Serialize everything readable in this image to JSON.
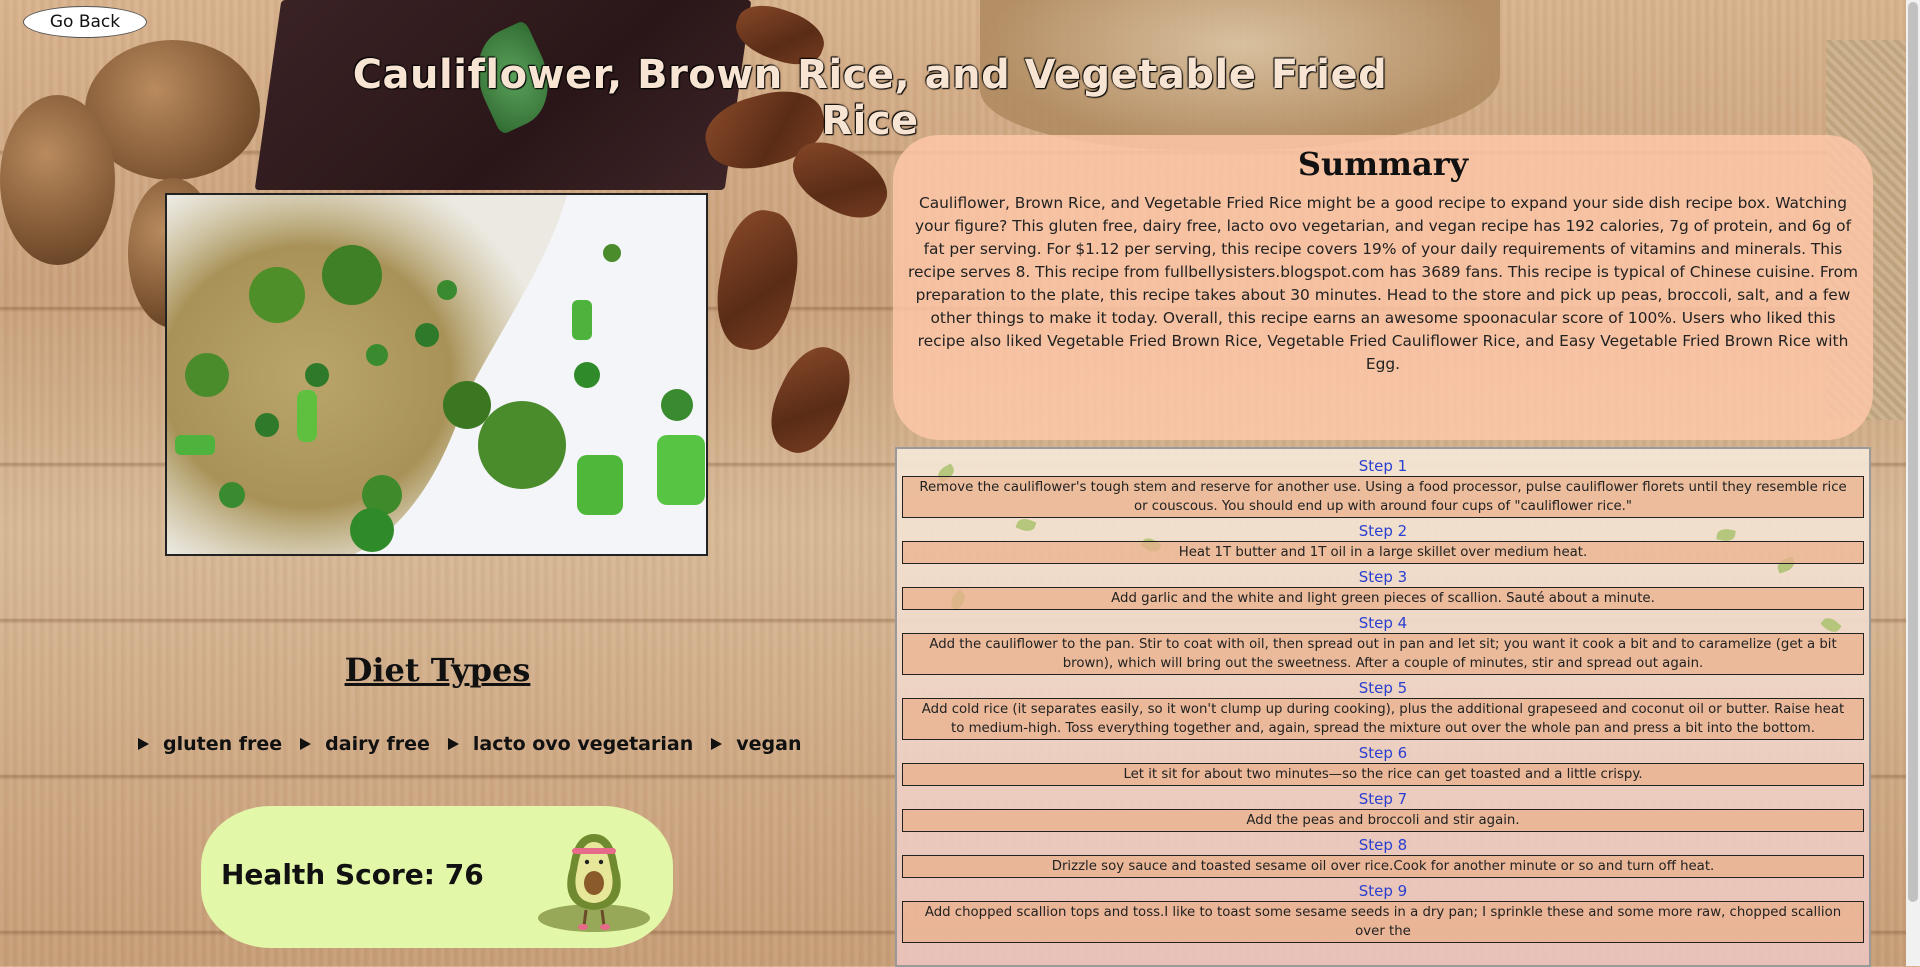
{
  "nav": {
    "go_back_label": "Go Back"
  },
  "recipe": {
    "title": "Cauliflower, Brown Rice, and Vegetable Fried Rice"
  },
  "summary": {
    "heading": "Summary",
    "text": "Cauliflower, Brown Rice, and Vegetable Fried Rice might be a good recipe to expand your side dish recipe box. Watching your figure? This gluten free, dairy free, lacto ovo vegetarian, and vegan recipe has 192 calories, 7g of protein, and 6g of fat per serving. For $1.12 per serving, this recipe covers 19% of your daily requirements of vitamins and minerals. This recipe serves 8. This recipe from fullbellysisters.blogspot.com has 3689 fans. This recipe is typical of Chinese cuisine. From preparation to the plate, this recipe takes about 30 minutes. Head to the store and pick up peas, broccoli, salt, and a few other things to make it today. Overall, this recipe earns an awesome spoonacular score of 100%. Users who liked this recipe also liked Vegetable Fried Brown Rice, Vegetable Fried Cauliflower Rice, and Easy Vegetable Fried Brown Rice with Egg."
  },
  "diet": {
    "heading": "Diet Types",
    "types": [
      "gluten free",
      "dairy free",
      "lacto ovo vegetarian",
      "vegan"
    ]
  },
  "health": {
    "label": "Health Score: 76",
    "score": 76
  },
  "steps": [
    {
      "label": "Step 1",
      "text": "Remove the cauliflower's tough stem and reserve for another use. Using a food processor, pulse cauliflower florets until they resemble rice or couscous. You should end up with around four cups of \"cauliflower rice.\""
    },
    {
      "label": "Step 2",
      "text": "Heat 1T butter and 1T oil in a large skillet over medium heat."
    },
    {
      "label": "Step 3",
      "text": "Add garlic and the white and light green pieces of scallion. Sauté about a minute."
    },
    {
      "label": "Step 4",
      "text": "Add the cauliflower to the pan. Stir to coat with oil, then spread out in pan and let sit; you want it cook a bit and to caramelize (get a bit brown), which will bring out the sweetness. After a couple of minutes, stir and spread out again."
    },
    {
      "label": "Step 5",
      "text": "Add cold rice (it separates easily, so it won't clump up during cooking), plus the additional grapeseed and coconut oil or butter. Raise heat to medium-high. Toss everything together and, again, spread the mixture out over the whole pan and press a bit into the bottom."
    },
    {
      "label": "Step 6",
      "text": "Let it sit for about two minutes—so the rice can get toasted and a little crispy."
    },
    {
      "label": "Step 7",
      "text": "Add the peas and broccoli and stir again."
    },
    {
      "label": "Step 8",
      "text": "Drizzle soy sauce and toasted sesame oil over rice.Cook for another minute or so and turn off heat."
    },
    {
      "label": "Step 9",
      "text": "Add chopped scallion tops and toss.I like to toast some sesame seeds in a dry pan; I sprinkle these and some more raw, chopped scallion over the"
    }
  ]
}
